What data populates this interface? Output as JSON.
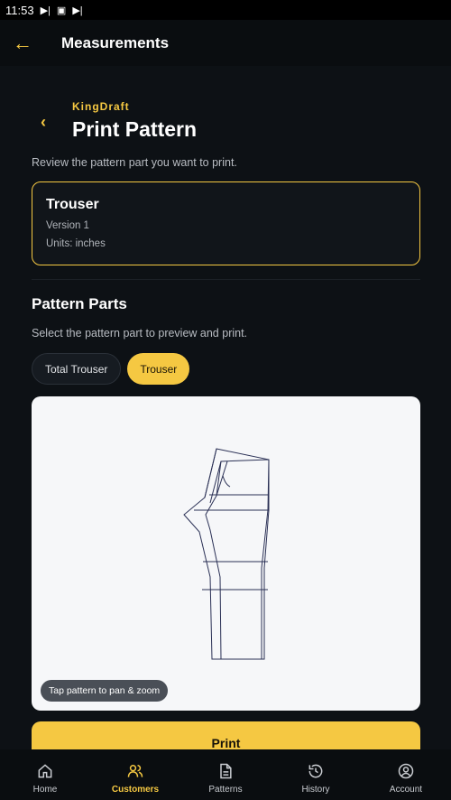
{
  "statusbar": {
    "time": "11:53"
  },
  "appbar": {
    "title": "Measurements"
  },
  "header": {
    "brand": "KingDraft",
    "title": "Print Pattern",
    "subtitle": "Review the pattern part you want to print."
  },
  "card": {
    "name": "Trouser",
    "version": "Version 1",
    "units": "Units: inches"
  },
  "parts": {
    "title": "Pattern Parts",
    "subtitle": "Select the pattern part to preview and print.",
    "chips": [
      {
        "label": "Total Trouser",
        "selected": false
      },
      {
        "label": "Trouser",
        "selected": true
      }
    ]
  },
  "preview": {
    "hint": "Tap pattern to pan & zoom"
  },
  "print_label": "Print",
  "nav": [
    {
      "label": "Home",
      "icon": "home-icon"
    },
    {
      "label": "Customers",
      "icon": "customers-icon",
      "active": true
    },
    {
      "label": "Patterns",
      "icon": "patterns-icon"
    },
    {
      "label": "History",
      "icon": "history-icon"
    },
    {
      "label": "Account",
      "icon": "account-icon"
    }
  ],
  "colors": {
    "accent": "#f5c842",
    "background": "#0c1014"
  }
}
